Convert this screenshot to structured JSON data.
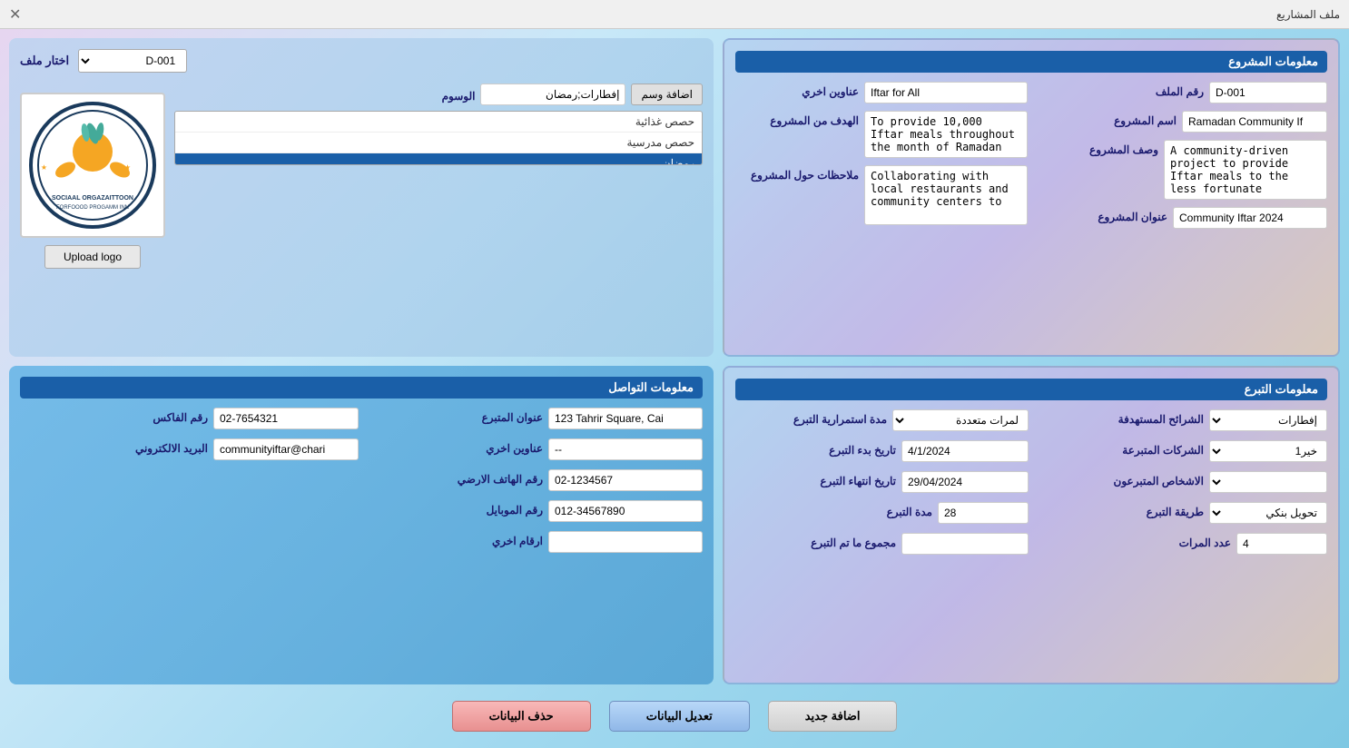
{
  "titleBar": {
    "title": "ملف المشاريع",
    "closeBtn": "✕"
  },
  "projectInfoPanel": {
    "title": "معلومات المشروع",
    "fileNumberLabel": "رقم الملف",
    "fileNumberValue": "D-001",
    "projectNameLabel": "اسم المشروع",
    "projectNameValue": "Ramadan Community If",
    "projectDescLabel": "وصف المشروع",
    "projectDescValue": "A community-driven project to provide Iftar meals to the less fortunate",
    "projectAddressLabel": "عنوان المشروع",
    "projectAddressValue": "Community Iftar 2024",
    "otherTitlesLabel": "عناوين اخري",
    "otherTitlesValue": "Iftar for All",
    "projectGoalLabel": "الهدف من المشروع",
    "projectGoalValue": "To provide 10,000 Iftar meals throughout the month of Ramadan",
    "projectNotesLabel": "ملاحظات حول المشروع",
    "projectNotesValue": "Collaborating with local restaurants and community centers to"
  },
  "rightPanel": {
    "fileSelectorLabel": "اختار ملف",
    "fileSelectorValue": "D-001",
    "tagsLabel": "الوسوم",
    "tagsInputValue": "إفطارات;رمضان",
    "tagsList": [
      {
        "label": "حصص غذائية",
        "selected": false
      },
      {
        "label": "حصص مدرسية",
        "selected": false
      },
      {
        "label": "رمضان",
        "selected": true
      }
    ],
    "addTagBtn": "اضافة وسم",
    "uploadLogoBtn": "Upload logo"
  },
  "donationPanel": {
    "title": "معلومات التبرع",
    "targetSegmentsLabel": "الشرائح المستهدفة",
    "targetSegmentsValue": "إفطارات",
    "donatingCompaniesLabel": "الشركات المتبرعة",
    "donatingCompaniesValue": "خير1",
    "donatingPersonsLabel": "الاشخاص المتبرعون",
    "donatingPersonsValue": "",
    "donationMethodLabel": "طريقة التبرع",
    "donationMethodValue": "تحويل بنكي",
    "timesCountLabel": "عدد المرات",
    "timesCountValue": "4",
    "donationDurationLabel": "مدة استمرارية التبرع",
    "donationDurationValue": "لمرات متعددة",
    "startDateLabel": "تاريخ بدء التبرع",
    "startDateValue": "4/1/2024",
    "endDateLabel": "تاريخ انتهاء التبرع",
    "endDateValue": "29/04/2024",
    "durationLabel": "مدة التبرع",
    "durationValue": "28",
    "totalDonatedLabel": "مجموع ما تم التبرع",
    "totalDonatedValue": ""
  },
  "contactPanel": {
    "title": "معلومات التواصل",
    "donorAddressLabel": "عنوان المتبرع",
    "donorAddressValue": "123 Tahrir Square, Cai",
    "otherAddressLabel": "عناوين اخري",
    "otherAddressValue": "--",
    "landlineLabel": "رقم الهاتف الارضي",
    "landlineValue": "02-1234567",
    "mobileLabel": "رقم الموبايل",
    "mobileValue": "012-34567890",
    "otherNumbersLabel": "ارقام اخري",
    "otherNumbersValue": "",
    "faxLabel": "رقم الفاكس",
    "faxValue": "02-7654321",
    "emailLabel": "البريد الالكتروني",
    "emailValue": "communityiftar@chari"
  },
  "bottomButtons": {
    "addNew": "اضافة جديد",
    "editData": "تعديل البيانات",
    "deleteData": "حذف البيانات"
  }
}
